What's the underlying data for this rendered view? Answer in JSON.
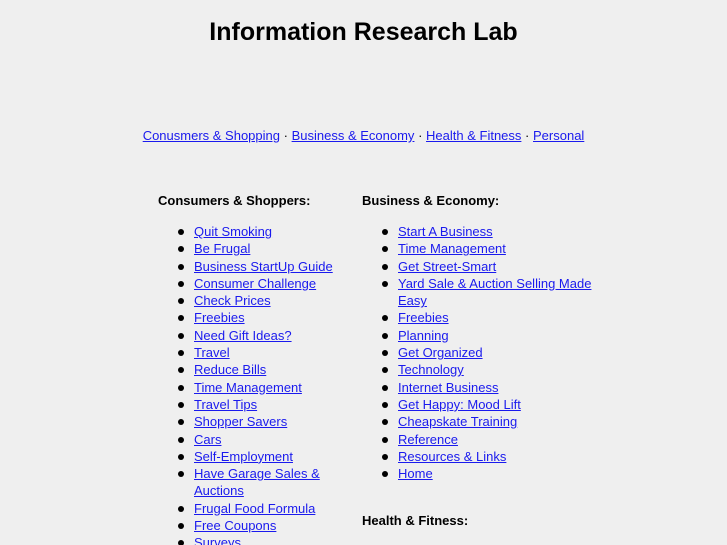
{
  "page": {
    "title": "Information Research Lab"
  },
  "topnav": {
    "separator": "·",
    "links": [
      {
        "label": "Conusmers & Shopping"
      },
      {
        "label": "Business & Economy"
      },
      {
        "label": "Health & Fitness"
      },
      {
        "label": "Personal"
      }
    ]
  },
  "consumers": {
    "heading": "Consumers & Shoppers:",
    "items": [
      {
        "label": "Quit Smoking"
      },
      {
        "label": "Be Frugal"
      },
      {
        "label": "Business StartUp Guide"
      },
      {
        "label": "Consumer Challenge"
      },
      {
        "label": "Check Prices"
      },
      {
        "label": "Freebies"
      },
      {
        "label": "Need Gift Ideas?"
      },
      {
        "label": "Travel"
      },
      {
        "label": "Reduce Bills"
      },
      {
        "label": "Time Management"
      },
      {
        "label": "Travel Tips"
      },
      {
        "label": "Shopper Savers"
      },
      {
        "label": "Cars"
      },
      {
        "label": "Self-Employment"
      },
      {
        "label": "Have Garage Sales & Auctions"
      },
      {
        "label": "Frugal Food Formula"
      },
      {
        "label": "Free Coupons"
      },
      {
        "label": "Surveys"
      }
    ]
  },
  "business": {
    "heading": "Business & Economy:",
    "items": [
      {
        "label": "Start A Business"
      },
      {
        "label": "Time Management"
      },
      {
        "label": "Get Street-Smart"
      },
      {
        "label": "Yard Sale & Auction Selling Made Easy"
      },
      {
        "label": "Freebies"
      },
      {
        "label": "Planning"
      },
      {
        "label": "Get Organized"
      },
      {
        "label": "Technology"
      },
      {
        "label": "Internet Business"
      },
      {
        "label": "Get Happy: Mood Lift"
      },
      {
        "label": "Cheapskate Training"
      },
      {
        "label": "Reference"
      },
      {
        "label": "Resources & Links"
      },
      {
        "label": "Home"
      }
    ]
  },
  "health": {
    "heading": "Health & Fitness:"
  }
}
